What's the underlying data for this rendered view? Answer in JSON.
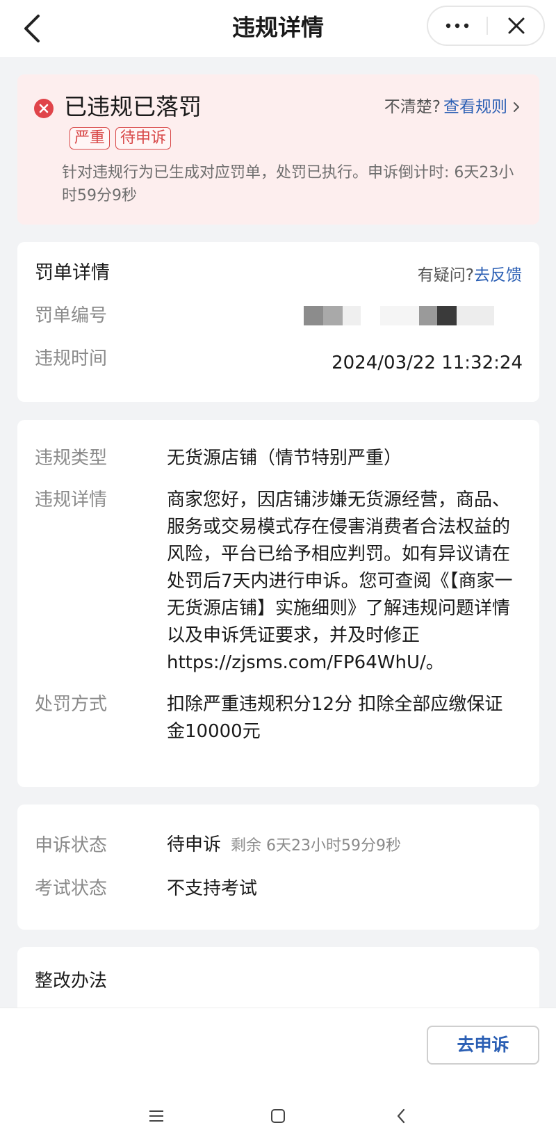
{
  "navbar": {
    "title": "违规详情",
    "back_icon": "chevron-left-icon",
    "more_icon": "more-dots-icon",
    "close_icon": "close-icon"
  },
  "status": {
    "icon": "error-circle-icon",
    "title": "已违规已落罚",
    "rule_hint": "不清楚?",
    "rule_link": "查看规则",
    "tags": [
      "严重",
      "待申诉"
    ],
    "description": "针对违规行为已生成对应罚单，处罚已执行。申诉倒计时: 6天23小时59分9秒",
    "colors": {
      "background": "#fdeeee",
      "accent": "#d84848",
      "link": "#2b5fb4"
    }
  },
  "fine": {
    "title": "罚单详情",
    "feedback_question": "有疑问?",
    "feedback_link": "去反馈",
    "number_label": "罚单编号",
    "time_label": "违规时间",
    "time_value": "2024/03/22 11:32:24"
  },
  "detail": {
    "type_label": "违规类型",
    "type_value": "无货源店铺（情节特别严重）",
    "detail_label": "违规详情",
    "detail_value": "商家您好，因店铺涉嫌无货源经营，商品、服务或交易模式存在侵害消费者合法权益的风险，平台已给予相应判罚。如有异议请在处罚后7天内进行申诉。您可查阅《【商家一无货源店铺】实施细则》了解违规问题详情以及申诉凭证要求，并及时修正 https://zjsms.com/FP64WhU/。",
    "penalty_label": "处罚方式",
    "penalty_value": "扣除严重违规积分12分 扣除全部应缴保证金10000元"
  },
  "appeal": {
    "status_label": "申诉状态",
    "status_value": "待申诉",
    "remaining": "剩余 6天23小时59分9秒",
    "exam_label": "考试状态",
    "exam_value": "不支持考试"
  },
  "fix": {
    "title": "整改办法"
  },
  "bottom": {
    "appeal_button": "去申诉"
  },
  "system_nav": {
    "menu_icon": "menu-icon",
    "home_icon": "home-icon",
    "back_icon": "back-icon"
  }
}
